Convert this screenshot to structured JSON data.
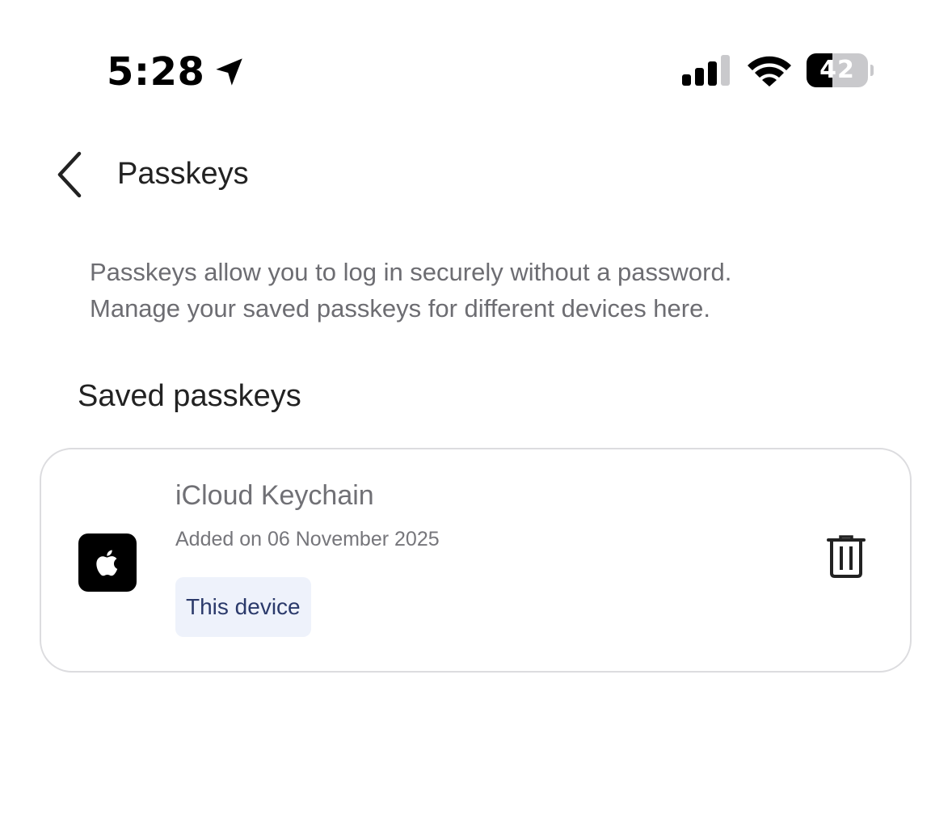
{
  "status_bar": {
    "time": "5:28",
    "battery_percent": "42",
    "battery_level": 0.42,
    "signal_bars": 3,
    "icons": [
      "location-arrow-icon",
      "cellular-signal-icon",
      "wifi-icon",
      "battery-icon"
    ]
  },
  "header": {
    "title": "Passkeys",
    "back_icon": "chevron-left-icon"
  },
  "description": {
    "line1": "Passkeys allow you to log in securely without a password.",
    "line2": "Manage your saved passkeys for different devices here."
  },
  "section": {
    "title": "Saved passkeys"
  },
  "passkeys": [
    {
      "name": "iCloud Keychain",
      "added": "Added on 06 November 2025",
      "badge": "This device",
      "provider_icon": "apple-logo-icon",
      "action_icon": "trash-icon"
    }
  ],
  "colors": {
    "title_text": "#222222",
    "secondary_text": "#6d6d72",
    "badge_bg": "#eef2fb",
    "badge_text": "#2b3a6b",
    "card_border": "#dcdcdf"
  }
}
